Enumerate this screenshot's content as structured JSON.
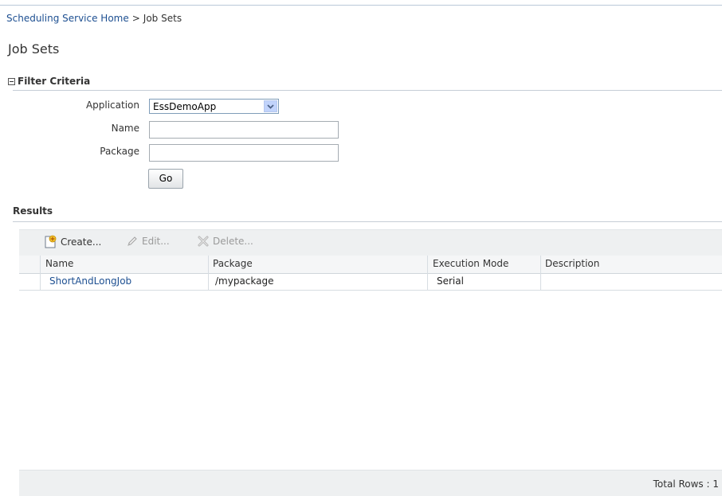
{
  "breadcrumb": {
    "home_link": "Scheduling Service Home",
    "separator": ">",
    "current": "Job Sets"
  },
  "page": {
    "title": "Job Sets"
  },
  "filter": {
    "section_title": "Filter Criteria",
    "application": {
      "label": "Application",
      "value": "EssDemoApp"
    },
    "name": {
      "label": "Name",
      "value": ""
    },
    "package": {
      "label": "Package",
      "value": ""
    },
    "go_label": "Go"
  },
  "results": {
    "title": "Results",
    "toolbar": {
      "create_label": "Create...",
      "edit_label": "Edit...",
      "delete_label": "Delete..."
    },
    "columns": [
      "Name",
      "Package",
      "Execution Mode",
      "Description"
    ],
    "rows": [
      {
        "name": "ShortAndLongJob",
        "package": "/mypackage",
        "execution_mode": "Serial",
        "description": ""
      }
    ],
    "total_rows": "Total Rows : 1"
  },
  "colors": {
    "link": "#1d4f91",
    "toolbar_bg": "#eef0f1",
    "disabled_text": "#9a9a9a"
  },
  "icons": [
    "collapse-icon",
    "dropdown-arrow-icon",
    "create-icon",
    "edit-pencil-icon",
    "delete-x-icon"
  ]
}
